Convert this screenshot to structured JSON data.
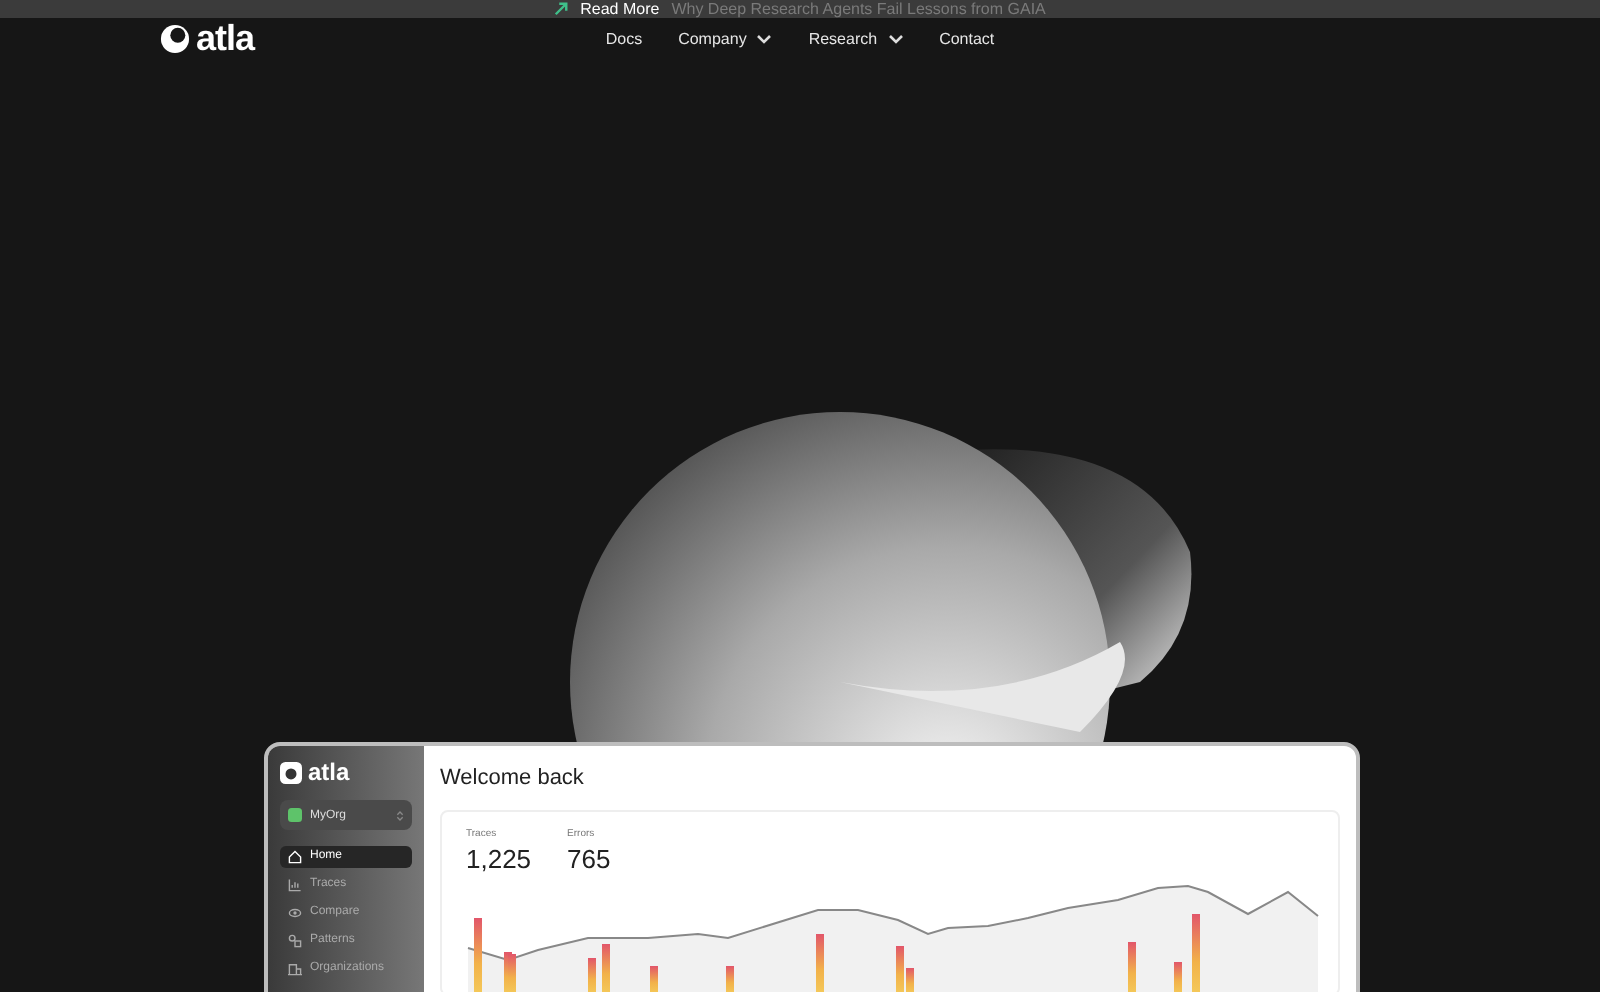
{
  "banner": {
    "link": "Read More",
    "headline": "Why Deep Research Agents Fail Lessons from GAIA"
  },
  "nav": {
    "logo": "atla",
    "links": [
      {
        "label": "Docs",
        "kind": "link"
      },
      {
        "label": "Company",
        "kind": "dropdown"
      },
      {
        "label": "Research",
        "kind": "dropdown"
      },
      {
        "label": "Contact",
        "kind": "link"
      }
    ]
  },
  "dashboard": {
    "logo": "atla",
    "org": "MyOrg",
    "sidebar": {
      "items": [
        {
          "label": "Home",
          "selected": true,
          "kind": "home"
        },
        {
          "label": "Traces",
          "selected": false,
          "kind": "traces"
        },
        {
          "label": "Compare",
          "selected": false,
          "kind": "compare"
        },
        {
          "label": "Patterns",
          "selected": false,
          "kind": "patterns"
        },
        {
          "label": "Organizations",
          "selected": false,
          "kind": "organizations"
        }
      ]
    },
    "title": "Welcome back",
    "stats": [
      {
        "label": "Traces",
        "value": "1,225"
      },
      {
        "label": "Errors",
        "value": "765"
      }
    ]
  }
}
